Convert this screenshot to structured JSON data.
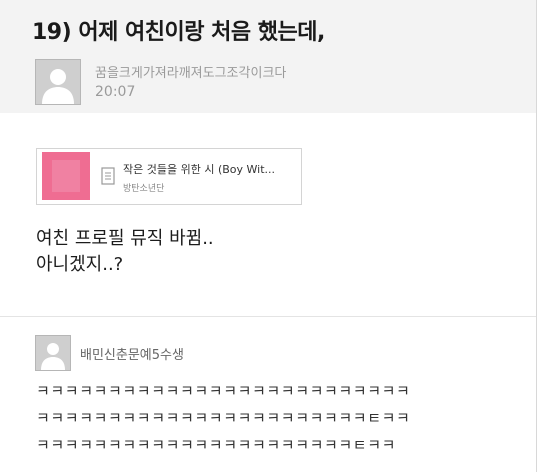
{
  "post": {
    "title": "19) 어제 여친이랑 처음 했는데,",
    "author": "꿈을크게가져라깨져도그조각이크다",
    "time": "20:07",
    "avatar_icon": "default-user-icon",
    "music": {
      "title": "작은 것들을 위한 시 (Boy Wit...",
      "artist": "방탄소년단",
      "art_color": "#ef6d92",
      "icon": "document-icon"
    },
    "body_lines": [
      "여친 프로필 뮤직 바뀜..",
      "아니겠지..?"
    ]
  },
  "comment": {
    "author": "배민신춘문예5수생",
    "avatar_icon": "default-user-icon",
    "lines": [
      "ㅋㅋㅋㅋㅋㅋㅋㅋㅋㅋㅋㅋㅋㅋㅋㅋㅋㅋㅋㅋㅋㅋㅋㅋㅋㅋ",
      "ㅋㅋㅋㅋㅋㅋㅋㅋㅋㅋㅋㅋㅋㅋㅋㅋㅋㅋㅋㅋㅋㅋㅋㅌㅋㅋ",
      "ㅋㅋㅋㅋㅋㅋㅋㅋㅋㅋㅋㅋㅋㅋㅋㅋㅋㅋㅋㅋㅋㅋㅌㅋㅋ"
    ]
  }
}
